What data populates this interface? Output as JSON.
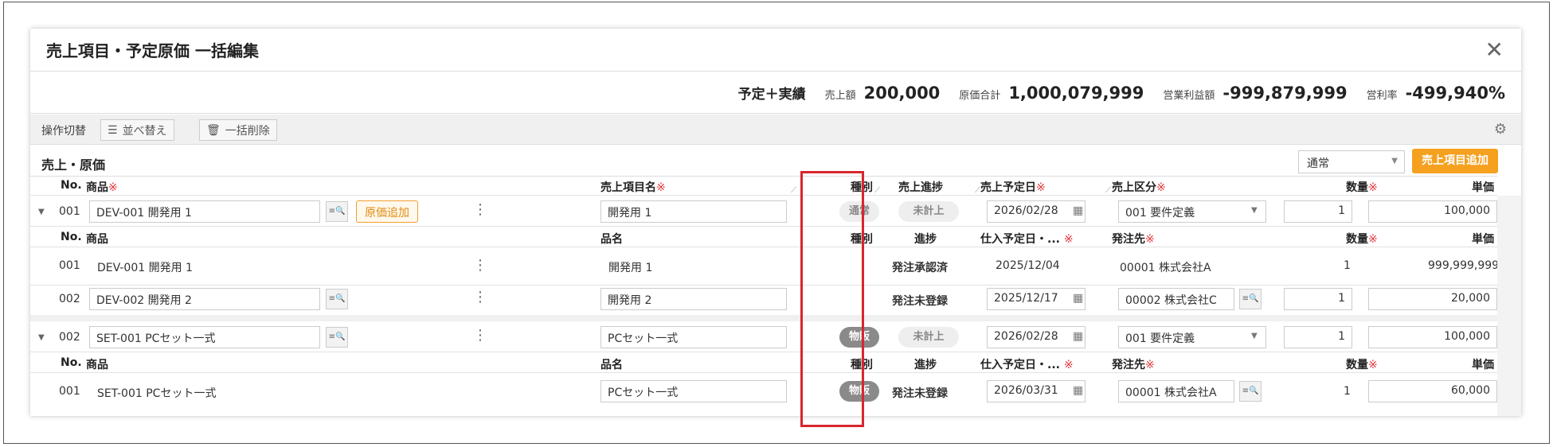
{
  "modal": {
    "title": "売上項目・予定原価 一括編集",
    "close_icon": "close-icon"
  },
  "summary": {
    "mode_label": "予定＋実績",
    "sales_label": "売上額",
    "sales_value": "200,000",
    "cost_label": "原価合計",
    "cost_value": "1,000,079,999",
    "profit_label": "営業利益額",
    "profit_value": "-999,879,999",
    "rate_label": "営利率",
    "rate_value": "-499,940%"
  },
  "toolbar": {
    "label": "操作切替",
    "sort_label": "並べ替え",
    "sort_icon": "sort-icon",
    "bulk_delete_label": "一括削除",
    "bulk_delete_icon": "trash-icon",
    "settings_icon": "gear-icon"
  },
  "section": {
    "title": "売上・原価",
    "select_value": "通常",
    "add_button": "売上項目追加"
  },
  "sales_headers": {
    "no": "No.",
    "product": "商品",
    "item_name": "売上項目名",
    "type": "種別",
    "progress": "売上進捗",
    "date": "売上予定日",
    "category": "売上区分",
    "qty": "数量",
    "unit_price": "単価"
  },
  "cost_headers": {
    "no": "No.",
    "product": "商品",
    "item_name": "品名",
    "type": "種別",
    "progress": "進捗",
    "date": "仕入予定日・...",
    "supplier": "発注先",
    "qty": "数量",
    "unit_price": "単価"
  },
  "required_mark": "※",
  "groups": [
    {
      "no": "001",
      "product": "DEV-001 開発用 1",
      "add_cost_label": "原価追加",
      "item_name": "開発用 1",
      "type": "通常",
      "progress": "未計上",
      "date": "2026/02/28",
      "category": "001 要件定義",
      "qty": "1",
      "unit_price": "100,000",
      "costs": [
        {
          "no": "001",
          "product": "DEV-001 開発用 1",
          "item_name": "開発用 1",
          "progress": "発注承認済",
          "date": "2025/12/04",
          "supplier": "00001 株式会社A",
          "qty": "1",
          "unit_price": "999,999,999"
        },
        {
          "no": "002",
          "product": "DEV-002 開発用 2",
          "item_name": "開発用 2",
          "progress": "発注未登録",
          "date": "2025/12/17",
          "supplier": "00002 株式会社C",
          "qty": "1",
          "unit_price": "20,000"
        }
      ]
    },
    {
      "no": "002",
      "product": "SET-001 PCセット一式",
      "item_name": "PCセット一式",
      "type": "物販",
      "progress": "未計上",
      "date": "2026/02/28",
      "category": "001 要件定義",
      "qty": "1",
      "unit_price": "100,000",
      "costs": [
        {
          "no": "001",
          "product": "SET-001 PCセット一式",
          "item_name": "PCセット一式",
          "type": "物販",
          "progress": "発注未登録",
          "date": "2026/03/31",
          "supplier": "00001 株式会社A",
          "qty": "1",
          "unit_price": "60,000"
        }
      ]
    }
  ]
}
